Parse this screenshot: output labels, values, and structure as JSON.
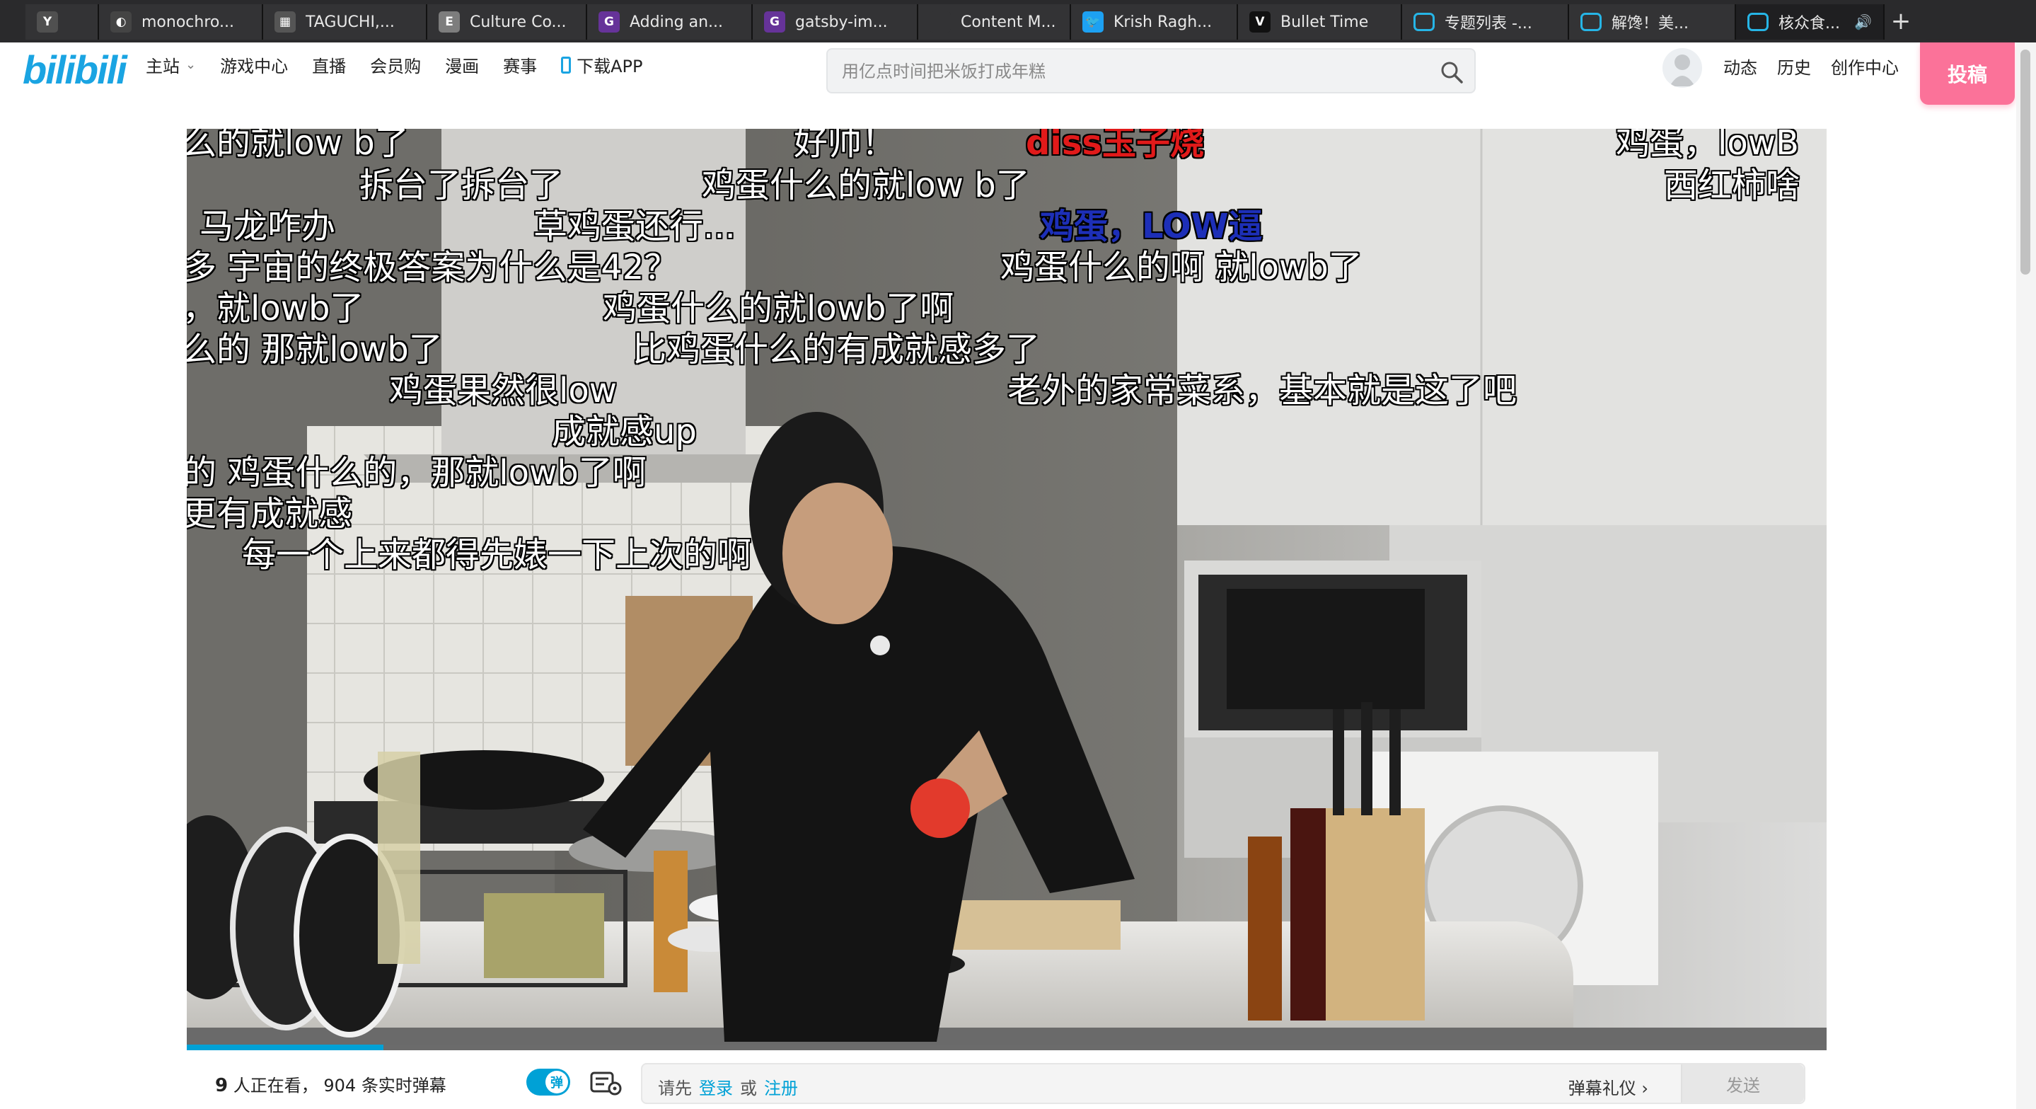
{
  "browser": {
    "tabs": [
      {
        "title": "",
        "favicon": "Y",
        "fav_color": "#505050",
        "active": false
      },
      {
        "title": "monochro...",
        "favicon": "◐",
        "fav_color": "#444444",
        "active": false
      },
      {
        "title": "TAGUCHI,...",
        "favicon": "▦",
        "fav_color": "#555555",
        "active": false
      },
      {
        "title": "Culture Co...",
        "favicon": "E",
        "fav_color": "#7d7d7d",
        "active": false
      },
      {
        "title": "Adding an...",
        "favicon": "G",
        "fav_color": "#663399",
        "active": false
      },
      {
        "title": "gatsby-im...",
        "favicon": "G",
        "fav_color": "#663399",
        "active": false
      },
      {
        "title": "Content M...",
        "favicon": "",
        "fav_color": "#333335",
        "active": false
      },
      {
        "title": "Krish Ragh...",
        "favicon": "🐦",
        "fav_color": "#1da1f2",
        "active": false
      },
      {
        "title": "Bullet Time",
        "favicon": "V",
        "fav_color": "#111111",
        "active": false
      },
      {
        "title": "专题列表 -...",
        "favicon": "tv",
        "fav_color": "#26b5e6",
        "active": false
      },
      {
        "title": "解馋！美...",
        "favicon": "tv",
        "fav_color": "#26b5e6",
        "active": false
      },
      {
        "title": "核众食...",
        "favicon": "tv",
        "fav_color": "#26b5e6",
        "active": true,
        "audio": "🔊"
      }
    ],
    "new_tab": "+"
  },
  "site": {
    "logo": "bilibili",
    "nav": [
      "主站",
      "游戏中心",
      "直播",
      "会员购",
      "漫画",
      "赛事",
      "下载APP"
    ],
    "search_placeholder": "用亿点时间把米饭打成年糕",
    "right_nav": [
      "动态",
      "历史",
      "创作中心"
    ],
    "upload": "投稿"
  },
  "danmaku": [
    {
      "text": "么的就low b了",
      "color": "#ffffff"
    },
    {
      "text": "好帅！",
      "color": "#ffffff"
    },
    {
      "text": "diss玉子烧",
      "color": "#e11a1a",
      "bold": true
    },
    {
      "text": "鸡蛋，lowB",
      "color": "#ffffff"
    },
    {
      "text": "拆台了拆台了",
      "color": "#ffffff"
    },
    {
      "text": "鸡蛋什么的就low b了",
      "color": "#ffffff"
    },
    {
      "text": "西红柿啥",
      "color": "#ffffff"
    },
    {
      "text": "马龙咋办",
      "color": "#ffffff"
    },
    {
      "text": "草鸡蛋还行...",
      "color": "#ffffff"
    },
    {
      "text": "鸡蛋，LOW逼",
      "color": "#1d2fb8",
      "bold": true
    },
    {
      "text": "多  宇宙的终极答案为什么是42？",
      "color": "#ffffff"
    },
    {
      "text": "鸡蛋什么的啊 就lowb了",
      "color": "#ffffff"
    },
    {
      "text": "，就lowb了",
      "color": "#ffffff"
    },
    {
      "text": "鸡蛋什么的就lowb了啊",
      "color": "#ffffff"
    },
    {
      "text": "么的   那就lowb了",
      "color": "#ffffff"
    },
    {
      "text": "比鸡蛋什么的有成就感多了",
      "color": "#ffffff"
    },
    {
      "text": "鸡蛋果然很low",
      "color": "#ffffff"
    },
    {
      "text": "老外的家常菜系，基本就是这了吧",
      "color": "#ffffff"
    },
    {
      "text": "成就感up",
      "color": "#ffffff"
    },
    {
      "text": "的   鸡蛋什么的，那就lowb了啊",
      "color": "#ffffff"
    },
    {
      "text": "更有成就感",
      "color": "#ffffff"
    },
    {
      "text": "每一个上来都得先婊一下上次的啊",
      "color": "#ffffff"
    }
  ],
  "progress": {
    "played_fraction": 0.12
  },
  "bottom": {
    "viewer_count": "9",
    "viewer_text": "人正在看，",
    "danmaku_count_text": "904 条实时弹幕",
    "danmaku_toggle": "弹",
    "input_prefix": "请先",
    "login": "登录",
    "or": "或",
    "register": "注册",
    "etiquette": "弹幕礼仪 ›",
    "send": "发送"
  },
  "colors": {
    "brand_blue": "#00a1d6",
    "upload_pink": "#fb7299"
  }
}
